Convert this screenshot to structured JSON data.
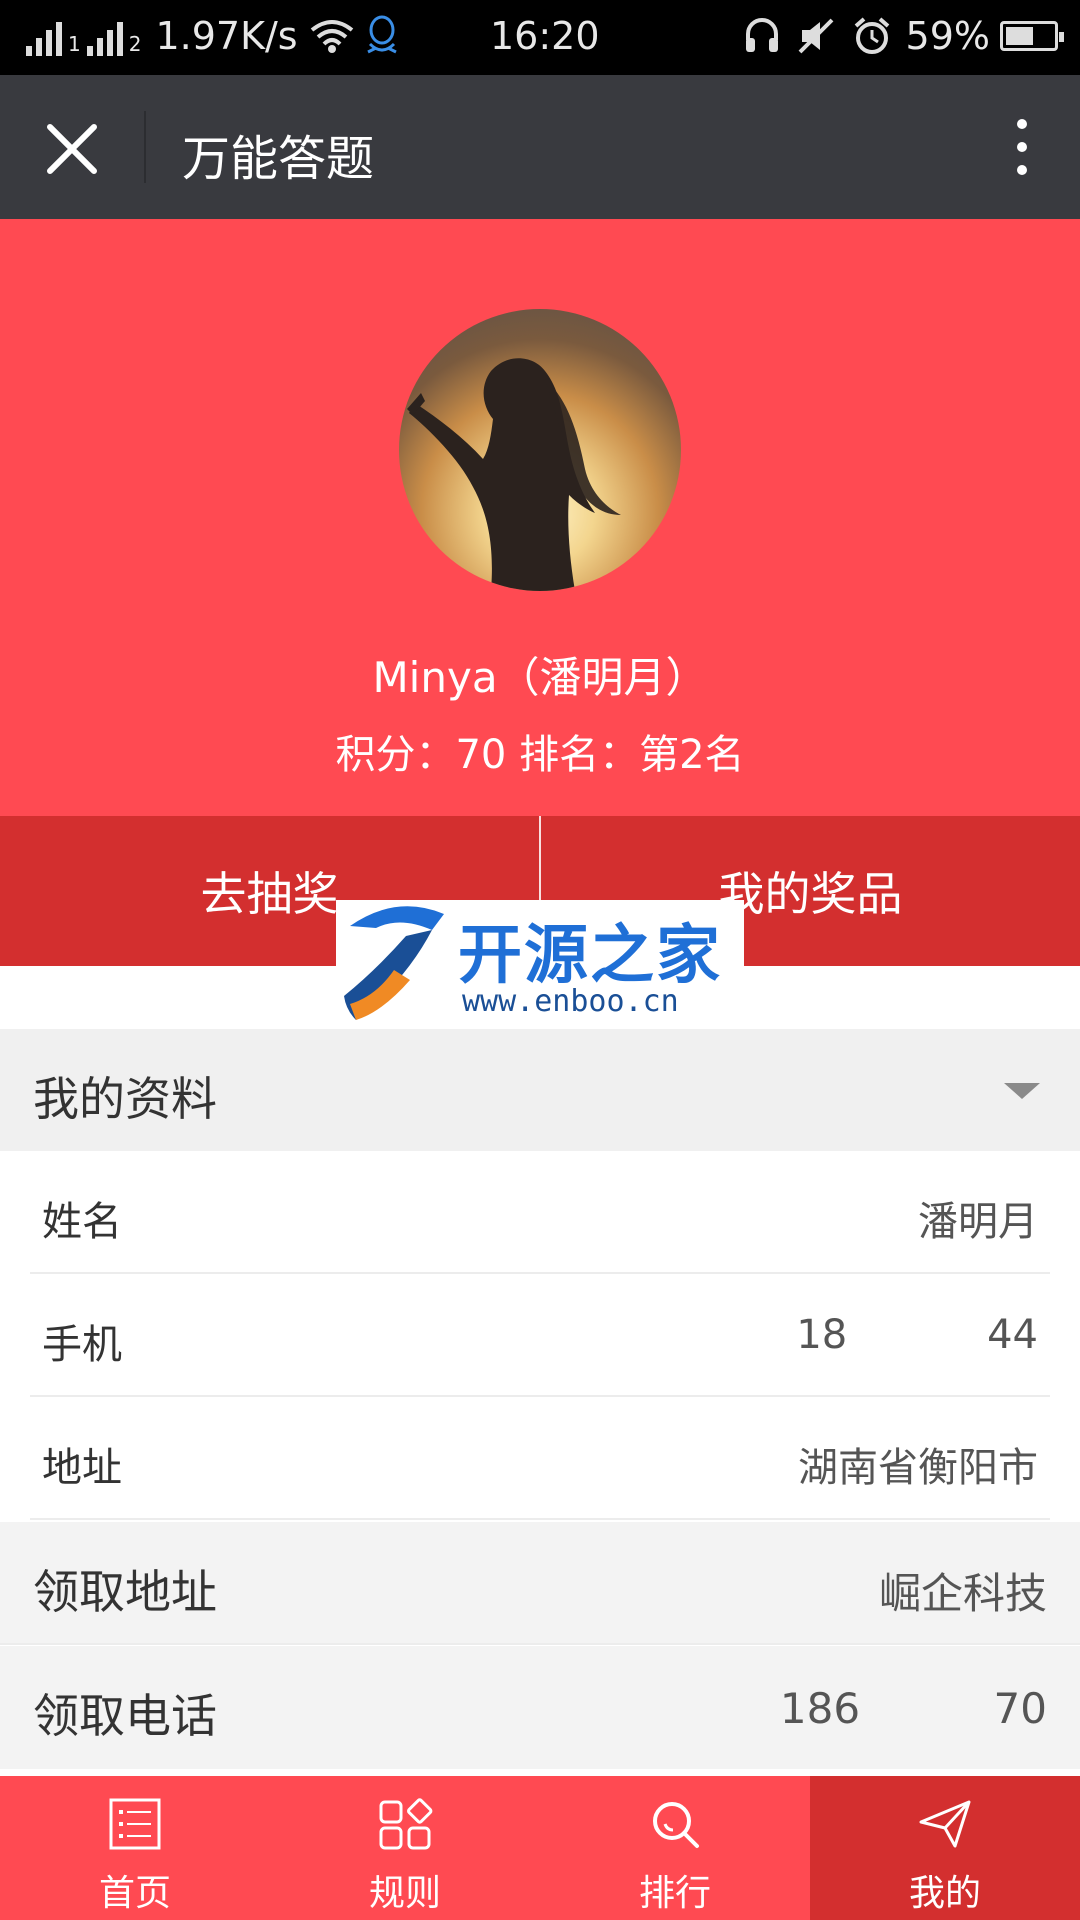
{
  "status_bar": {
    "network_speed": "1.97K/s",
    "time": "16:20",
    "battery": "59%",
    "battery_level": 0.59,
    "sim1": "1",
    "sim2": "2"
  },
  "title_bar": {
    "title": "万能答题"
  },
  "profile": {
    "name": "Minya（潘明月）",
    "score_line": "积分：70 排名：第2名"
  },
  "actions": {
    "lottery_label": "去抽奖",
    "prizes_label": "我的奖品"
  },
  "watermark": {
    "brand": "开源之家",
    "url": "www.enboo.cn"
  },
  "my_profile": {
    "section_title": "我的资料",
    "rows": [
      {
        "label": "姓名",
        "value": "潘明月"
      },
      {
        "label": "手机",
        "value": "18           44"
      },
      {
        "label": "地址",
        "value": "湖南省衡阳市"
      }
    ]
  },
  "pickup": {
    "address_label": "领取地址",
    "address_value": "崛企科技",
    "phone_label": "领取电话",
    "phone_value": "186          70"
  },
  "tabbar": {
    "items": [
      {
        "label": "首页",
        "icon": "list-icon"
      },
      {
        "label": "规则",
        "icon": "grid-icon"
      },
      {
        "label": "排行",
        "icon": "search-icon"
      },
      {
        "label": "我的",
        "icon": "send-icon"
      }
    ],
    "active_index": 3
  },
  "colors": {
    "primary": "#ff4a52",
    "primary_dark": "#d32f2f",
    "titlebar": "#393a3f"
  }
}
